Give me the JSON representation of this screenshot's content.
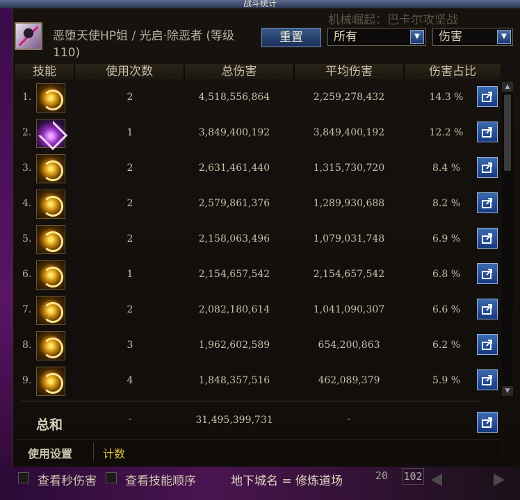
{
  "window": {
    "title": "战斗统计"
  },
  "character": {
    "name": "恶堕天使HP姐 / 光启·除恶者 (等级110)"
  },
  "controls": {
    "reset_label": "重置",
    "filter_selected": "所有",
    "metric_selected": "伤害",
    "background_title": "机械崛起：巴卡尔攻坚战"
  },
  "table": {
    "headers": [
      "技能",
      "使用次数",
      "总伤害",
      "平均伤害",
      "伤害占比"
    ],
    "rows": [
      {
        "rank": "1.",
        "icon": "skill-golden-swirl-icon",
        "count": "2",
        "total": "4,518,556,864",
        "avg": "2,259,278,432",
        "pct": "14.3 %"
      },
      {
        "rank": "2.",
        "icon": "skill-purple-burst-icon",
        "count": "1",
        "total": "3,849,400,192",
        "avg": "3,849,400,192",
        "pct": "12.2 %"
      },
      {
        "rank": "3.",
        "icon": "skill-golden-lightning-icon",
        "count": "2",
        "total": "2,631,461,440",
        "avg": "1,315,730,720",
        "pct": "8.4 %"
      },
      {
        "rank": "4.",
        "icon": "skill-golden-explosion-icon",
        "count": "2",
        "total": "2,579,861,376",
        "avg": "1,289,930,688",
        "pct": "8.2 %"
      },
      {
        "rank": "5.",
        "icon": "skill-golden-rays-icon",
        "count": "2",
        "total": "2,158,063,496",
        "avg": "1,079,031,748",
        "pct": "6.9 %"
      },
      {
        "rank": "6.",
        "icon": "skill-golden-orb-icon",
        "count": "1",
        "total": "2,154,657,542",
        "avg": "2,154,657,542",
        "pct": "6.8 %"
      },
      {
        "rank": "7.",
        "icon": "skill-golden-gate-icon",
        "count": "2",
        "total": "2,082,180,614",
        "avg": "1,041,090,307",
        "pct": "6.6 %"
      },
      {
        "rank": "8.",
        "icon": "skill-golden-strike-icon",
        "count": "3",
        "total": "1,962,602,589",
        "avg": "654,200,863",
        "pct": "6.2 %"
      },
      {
        "rank": "9.",
        "icon": "skill-golden-slash-icon",
        "count": "4",
        "total": "1,848,357,516",
        "avg": "462,089,379",
        "pct": "5.9 %"
      }
    ],
    "total": {
      "label": "总和",
      "count": "-",
      "total": "31,495,399,731",
      "avg": "-"
    }
  },
  "settings": {
    "label": "使用设置",
    "counter_label": "计数"
  },
  "bottom": {
    "chk_dps_label": "查看秒伤害",
    "chk_order_label": "查看技能顺序",
    "dungeon_text": "地下城名 = 修炼道场",
    "num_a": "20",
    "num_b": "102"
  },
  "colors": {
    "accent_blue": "#2a5aa0",
    "highlight_gold": "#e0c040"
  }
}
